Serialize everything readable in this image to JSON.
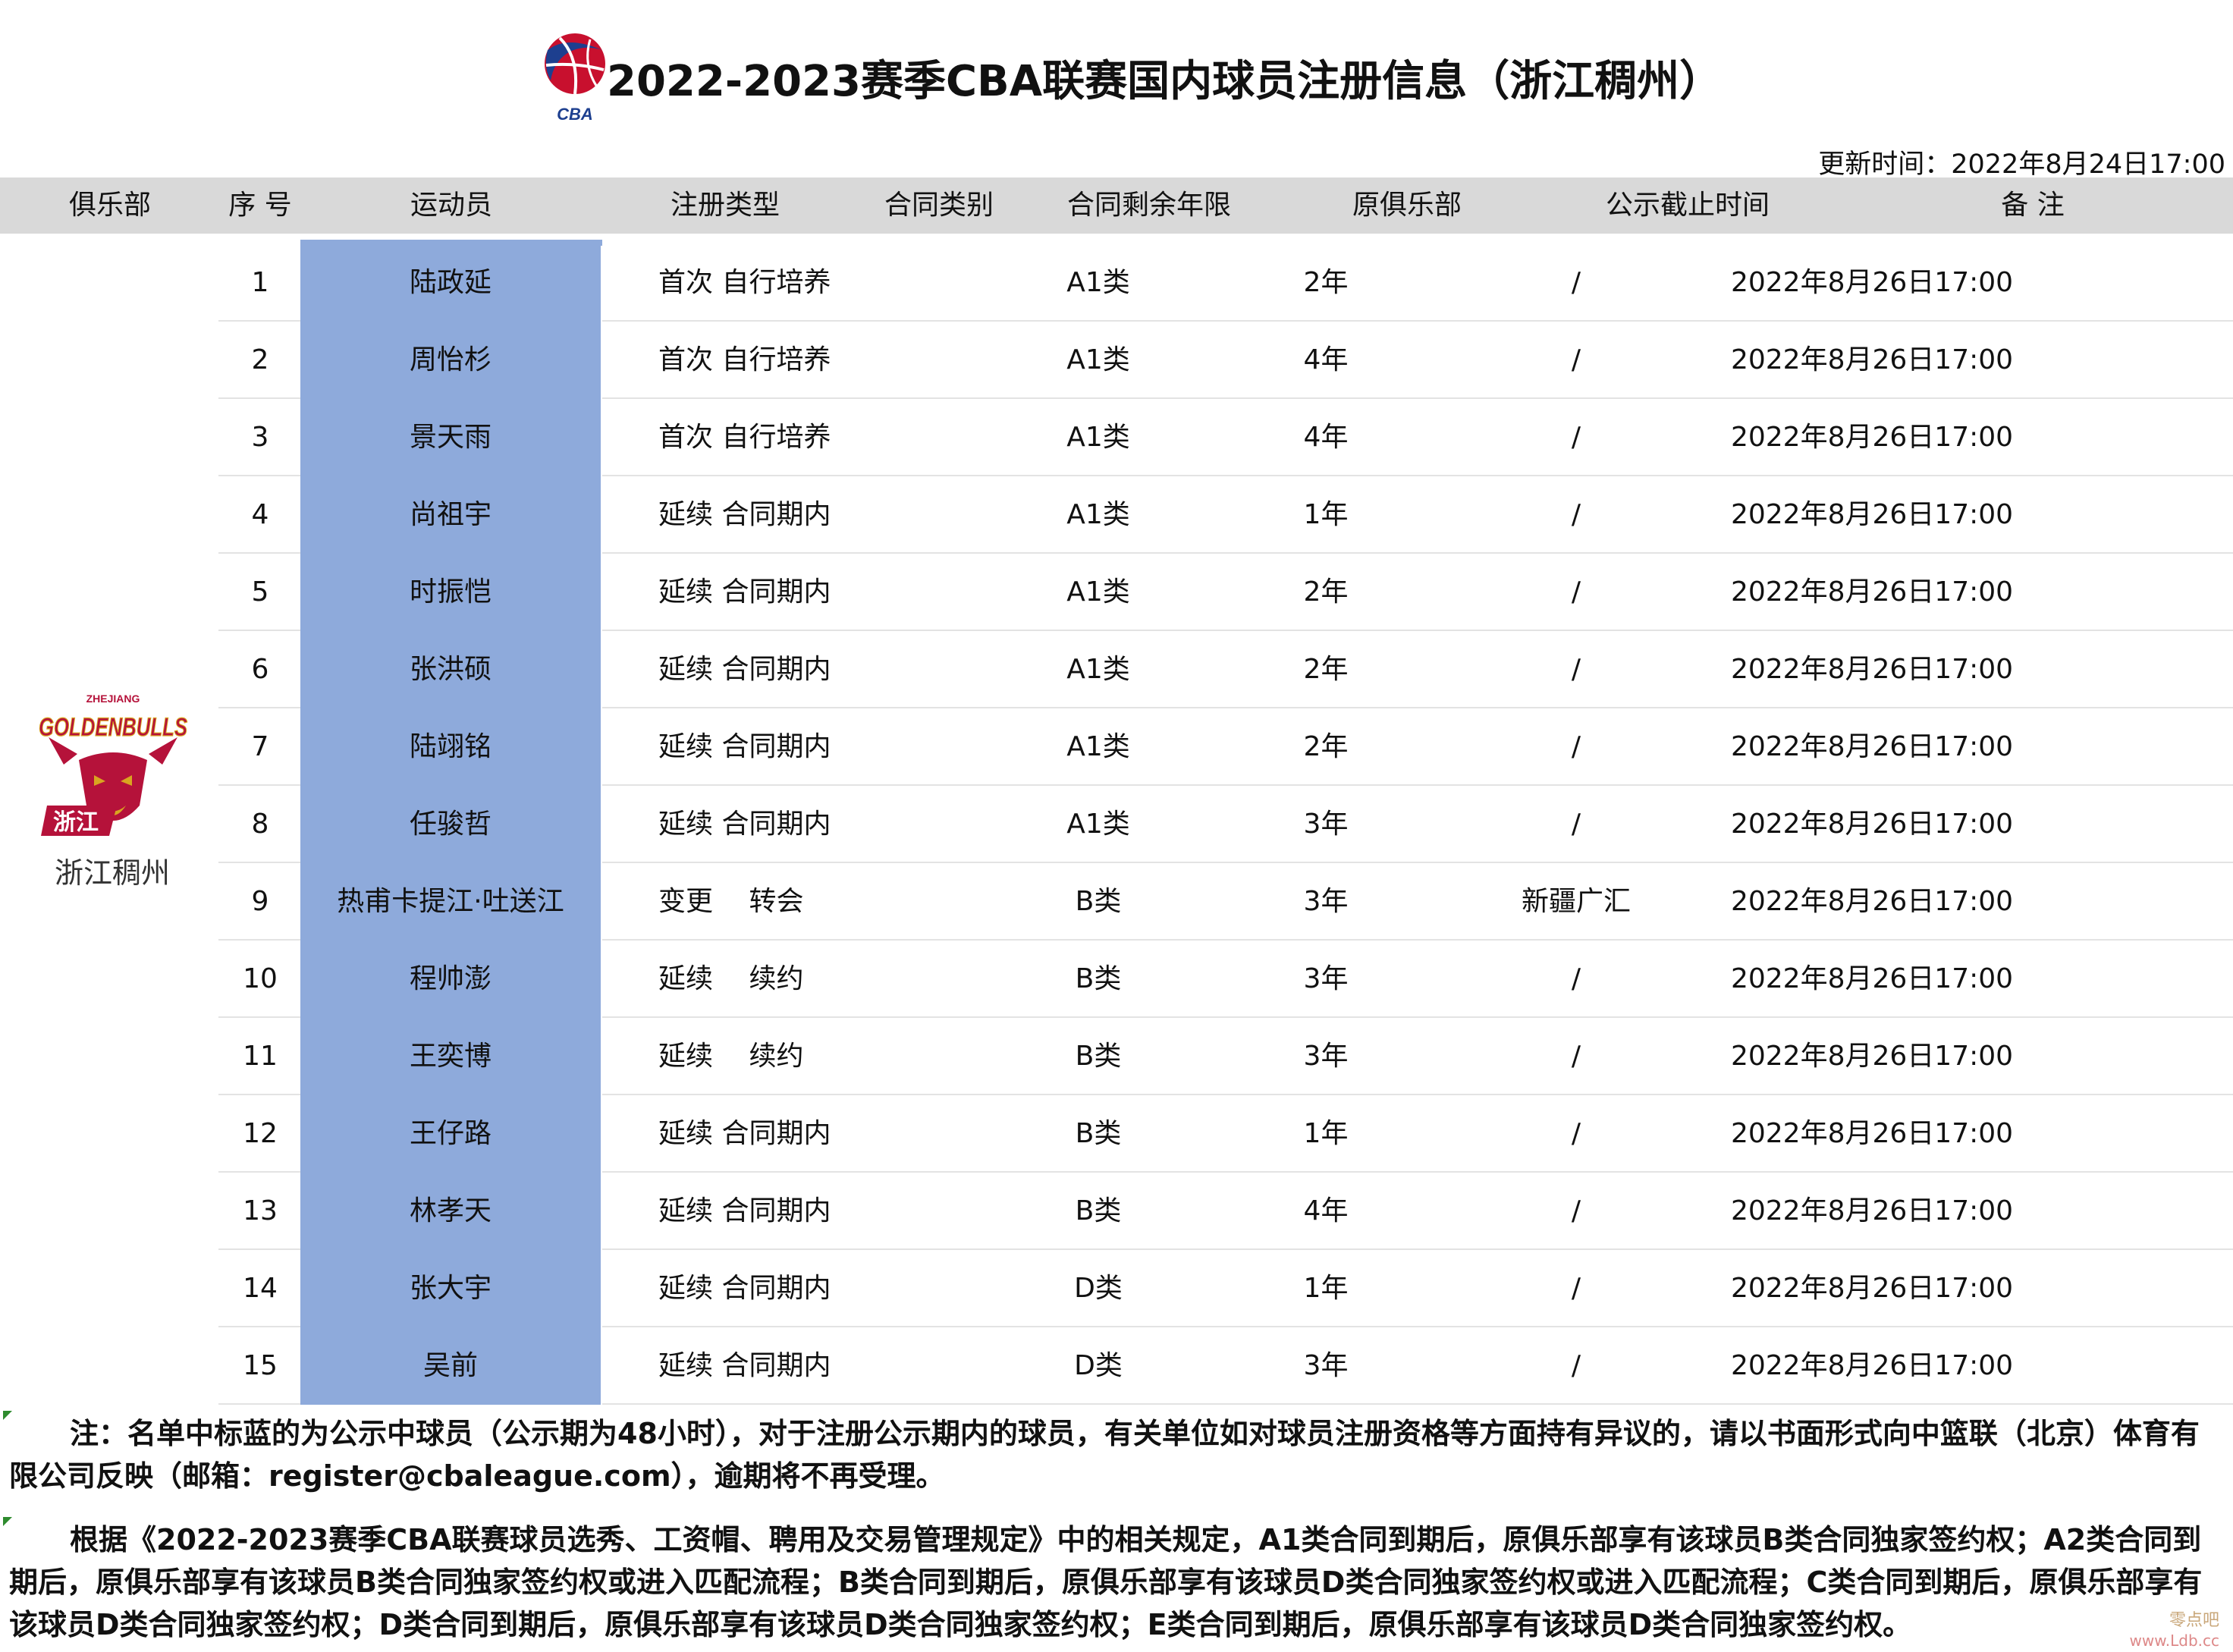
{
  "header": {
    "title": "2022-2023赛季CBA联赛国内球员注册信息（浙江稠州）",
    "logo_text": "CBA",
    "update_time": "更新时间：2022年8月24日17:00"
  },
  "columns": {
    "club": "俱乐部",
    "seq": "序 号",
    "player": "运动员",
    "reg_type": "注册类型",
    "contract_type": "合同类别",
    "years_left": "合同剩余年限",
    "prev_club": "原俱乐部",
    "deadline": "公示截止时间",
    "note": "备 注"
  },
  "club": {
    "name": "浙江稠州",
    "logo_text_top": "GOLDENBULLS",
    "logo_text_small": "ZHEJIANG",
    "logo_text_cn": "浙江"
  },
  "players": [
    {
      "seq": "1",
      "name": "陆政延",
      "reg_type": "首次 自行培养",
      "contract_type": "A1类",
      "years_left": "2年",
      "prev_club": "/",
      "deadline": "2022年8月26日17:00",
      "note": ""
    },
    {
      "seq": "2",
      "name": "周怡杉",
      "reg_type": "首次 自行培养",
      "contract_type": "A1类",
      "years_left": "4年",
      "prev_club": "/",
      "deadline": "2022年8月26日17:00",
      "note": ""
    },
    {
      "seq": "3",
      "name": "景天雨",
      "reg_type": "首次 自行培养",
      "contract_type": "A1类",
      "years_left": "4年",
      "prev_club": "/",
      "deadline": "2022年8月26日17:00",
      "note": ""
    },
    {
      "seq": "4",
      "name": "尚祖宇",
      "reg_type": "延续 合同期内",
      "contract_type": "A1类",
      "years_left": "1年",
      "prev_club": "/",
      "deadline": "2022年8月26日17:00",
      "note": ""
    },
    {
      "seq": "5",
      "name": "时振恺",
      "reg_type": "延续 合同期内",
      "contract_type": "A1类",
      "years_left": "2年",
      "prev_club": "/",
      "deadline": "2022年8月26日17:00",
      "note": ""
    },
    {
      "seq": "6",
      "name": "张洪硕",
      "reg_type": "延续 合同期内",
      "contract_type": "A1类",
      "years_left": "2年",
      "prev_club": "/",
      "deadline": "2022年8月26日17:00",
      "note": ""
    },
    {
      "seq": "7",
      "name": "陆翊铭",
      "reg_type": "延续 合同期内",
      "contract_type": "A1类",
      "years_left": "2年",
      "prev_club": "/",
      "deadline": "2022年8月26日17:00",
      "note": ""
    },
    {
      "seq": "8",
      "name": "任骏哲",
      "reg_type": "延续 合同期内",
      "contract_type": "A1类",
      "years_left": "3年",
      "prev_club": "/",
      "deadline": "2022年8月26日17:00",
      "note": ""
    },
    {
      "seq": "9",
      "name": "热甫卡提江·吐送江",
      "reg_type": "变更　 转会",
      "contract_type": "B类",
      "years_left": "3年",
      "prev_club": "新疆广汇",
      "deadline": "2022年8月26日17:00",
      "note": ""
    },
    {
      "seq": "10",
      "name": "程帅澎",
      "reg_type": "延续　 续约",
      "contract_type": "B类",
      "years_left": "3年",
      "prev_club": "/",
      "deadline": "2022年8月26日17:00",
      "note": ""
    },
    {
      "seq": "11",
      "name": "王奕博",
      "reg_type": "延续　 续约",
      "contract_type": "B类",
      "years_left": "3年",
      "prev_club": "/",
      "deadline": "2022年8月26日17:00",
      "note": ""
    },
    {
      "seq": "12",
      "name": "王仔路",
      "reg_type": "延续 合同期内",
      "contract_type": "B类",
      "years_left": "1年",
      "prev_club": "/",
      "deadline": "2022年8月26日17:00",
      "note": ""
    },
    {
      "seq": "13",
      "name": "林孝天",
      "reg_type": "延续 合同期内",
      "contract_type": "B类",
      "years_left": "4年",
      "prev_club": "/",
      "deadline": "2022年8月26日17:00",
      "note": ""
    },
    {
      "seq": "14",
      "name": "张大宇",
      "reg_type": "延续 合同期内",
      "contract_type": "D类",
      "years_left": "1年",
      "prev_club": "/",
      "deadline": "2022年8月26日17:00",
      "note": ""
    },
    {
      "seq": "15",
      "name": "吴前",
      "reg_type": "延续 合同期内",
      "contract_type": "D类",
      "years_left": "3年",
      "prev_club": "/",
      "deadline": "2022年8月26日17:00",
      "note": ""
    }
  ],
  "notes": {
    "note1": "注：名单中标蓝的为公示中球员（公示期为48小时），对于注册公示期内的球员，有关单位如对球员注册资格等方面持有异议的，请以书面形式向中篮联（北京）体育有限公司反映（邮箱：register@cbaleague.com），逾期将不再受理。",
    "note2": "根据《2022-2023赛季CBA联赛球员选秀、工资帽、聘用及交易管理规定》中的相关规定，A1类合同到期后，原俱乐部享有该球员B类合同独家签约权；A2类合同到期后，原俱乐部享有该球员B类合同独家签约权或进入匹配流程；B类合同到期后，原俱乐部享有该球员D类合同独家签约权或进入匹配流程；C类合同到期后，原俱乐部享有该球员D类合同独家签约权；D类合同到期后，原俱乐部享有该球员D类合同独家签约权；E类合同到期后，原俱乐部享有该球员D类合同独家签约权。"
  },
  "watermark": {
    "line1": "零点吧",
    "line2": "www.Ldb.cc"
  },
  "colors": {
    "highlight": "#8eaadb",
    "header_bg": "#d9d9d9",
    "cba_red": "#c8102e",
    "cba_blue": "#1d3f8f",
    "club_red": "#b5123a",
    "club_gold": "#d9a520"
  }
}
